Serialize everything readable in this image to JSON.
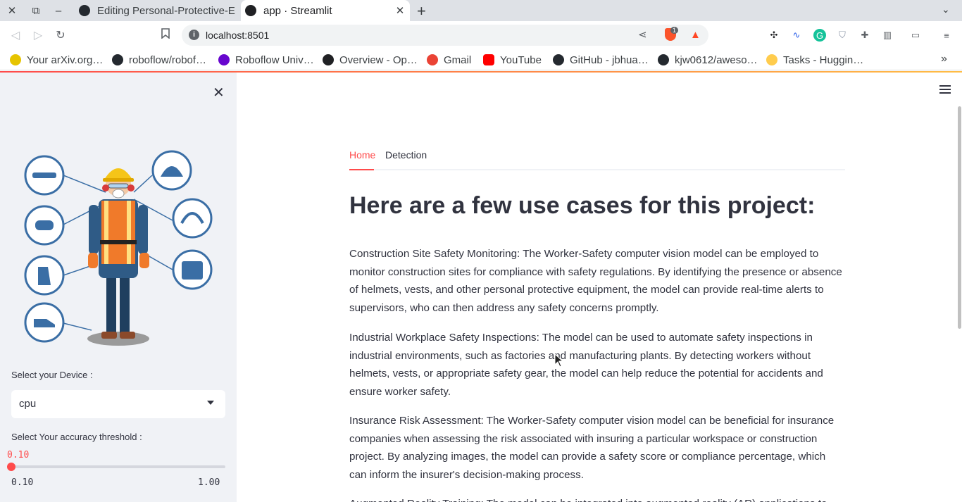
{
  "browser": {
    "tabs": [
      {
        "title": "Editing Personal-Protective-E",
        "active": false
      },
      {
        "title": "app · Streamlit",
        "active": true
      }
    ],
    "url": "localhost:8501",
    "brave_badge": "1",
    "bookmarks": [
      {
        "label": "Your arXiv.org…",
        "icon": "arxiv-icon",
        "color": "#e6c400"
      },
      {
        "label": "roboflow/robof…",
        "icon": "github-icon",
        "color": "#24292f"
      },
      {
        "label": "Roboflow Univ…",
        "icon": "roboflow-icon",
        "color": "#6706ce"
      },
      {
        "label": "Overview - Op…",
        "icon": "openai-icon",
        "color": "#202124"
      },
      {
        "label": "Gmail",
        "icon": "gmail-icon",
        "color": "#ea4335"
      },
      {
        "label": "YouTube",
        "icon": "youtube-icon",
        "color": "#ff0000"
      },
      {
        "label": "GitHub - jbhua…",
        "icon": "github-icon",
        "color": "#24292f"
      },
      {
        "label": "kjw0612/aweso…",
        "icon": "github-icon",
        "color": "#24292f"
      },
      {
        "label": "Tasks - Huggin…",
        "icon": "huggingface-icon",
        "color": "#ffcc4d"
      }
    ]
  },
  "sidebar": {
    "device_label": "Select your Device :",
    "device_value": "cpu",
    "threshold_label": "Select Your accuracy threshold :",
    "threshold_value": "0.10",
    "threshold_fraction": 0.0,
    "threshold_min": "0.10",
    "threshold_max": "1.00"
  },
  "main": {
    "tabs": [
      {
        "label": "Home",
        "active": true
      },
      {
        "label": "Detection",
        "active": false
      }
    ],
    "heading": "Here are a few use cases for this project:",
    "paragraphs": [
      "Construction Site Safety Monitoring: The Worker-Safety computer vision model can be employed to monitor construction sites for compliance with safety regulations. By identifying the presence or absence of helmets, vests, and other personal protective equipment, the model can provide real-time alerts to supervisors, who can then address any safety concerns promptly.",
      "Industrial Workplace Safety Inspections: The model can be used to automate safety inspections in industrial environments, such as factories and manufacturing plants. By detecting workers without helmets, vests, or appropriate safety gear, the model can help reduce the potential for accidents and ensure worker safety.",
      "Insurance Risk Assessment: The Worker-Safety computer vision model can be beneficial for insurance companies when assessing the risk associated with insuring a particular workspace or construction project. By analyzing images, the model can provide a safety score or compliance percentage, which can inform the insurer's decision-making process.",
      "Augmented Reality Training: The model can be integrated into augmented reality (AR) applications to"
    ]
  },
  "colors": {
    "accent": "#ff4b4b",
    "sidebar_bg": "#f0f2f6",
    "text": "#31333f"
  }
}
